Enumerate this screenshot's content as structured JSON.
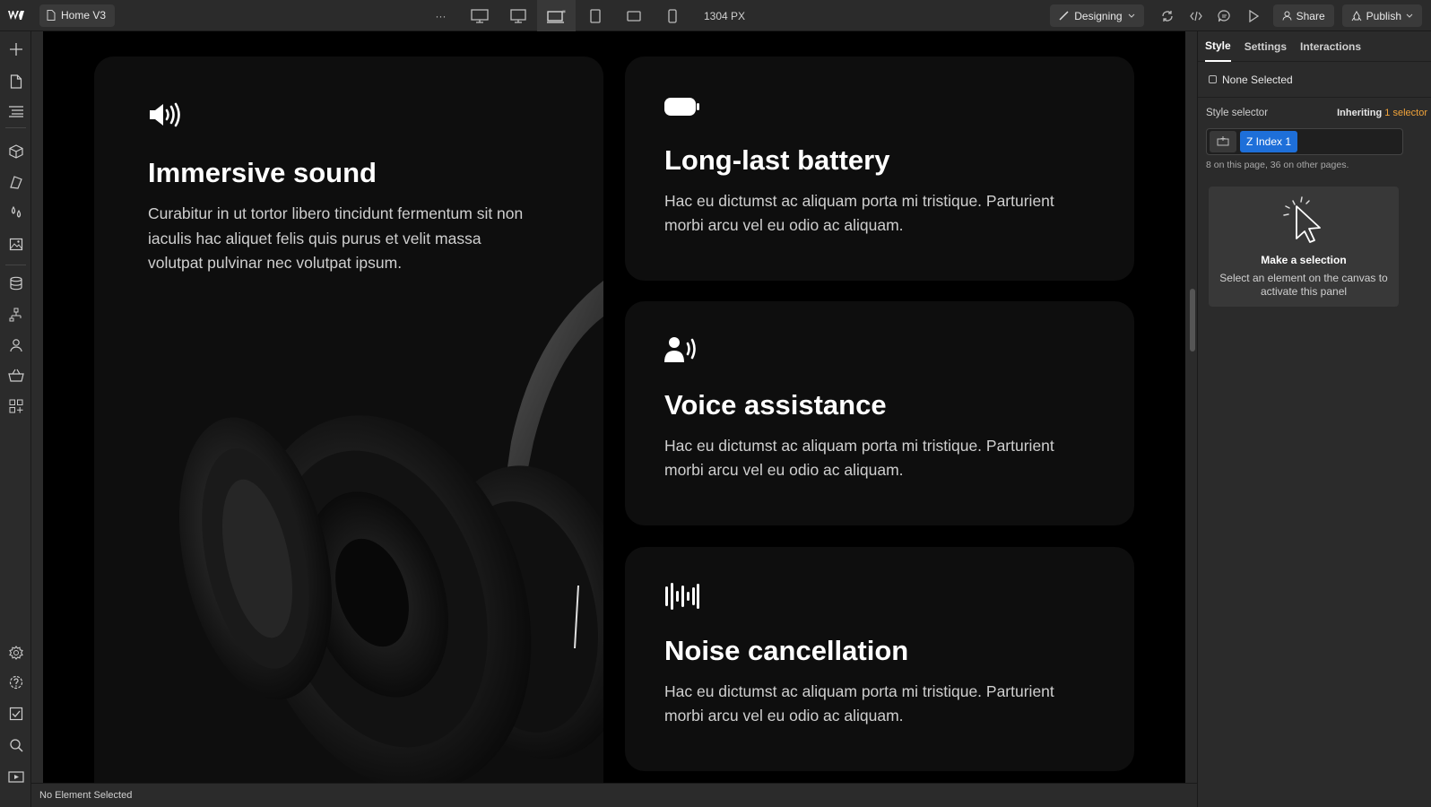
{
  "topbar": {
    "page_name": "Home V3",
    "more_label": "···",
    "width_readout": "1304 PX",
    "mode_label": "Designing",
    "share_label": "Share",
    "publish_label": "Publish"
  },
  "canvas": {
    "feature_main": {
      "title": "Immersive sound",
      "text": "Curabitur in ut tortor libero tincidunt fermentum sit non iaculis hac aliquet felis quis purus et velit massa volutpat pulvinar nec volutpat ipsum."
    },
    "features": [
      {
        "icon": "battery-icon",
        "title": "Long-last battery",
        "text": "Hac eu dictumst ac aliquam porta mi tristique. Parturient morbi arcu vel eu odio ac aliquam."
      },
      {
        "icon": "voice-icon",
        "title": "Voice assistance",
        "text": "Hac eu dictumst ac aliquam porta mi tristique. Parturient morbi arcu vel eu odio ac aliquam."
      },
      {
        "icon": "waveform-icon",
        "title": "Noise cancellation",
        "text": "Hac eu dictumst ac aliquam porta mi tristique. Parturient morbi arcu vel eu odio ac aliquam."
      }
    ]
  },
  "statusbar": {
    "text": "No Element Selected"
  },
  "panel": {
    "tabs": [
      "Style",
      "Settings",
      "Interactions"
    ],
    "none_selected": "None Selected",
    "style_selector_label": "Style selector",
    "inheriting_prefix": "Inheriting",
    "inheriting_count": "1 selector",
    "selector_chip": "Z Index 1",
    "count_note": "8 on this page, 36 on other pages.",
    "empty_title": "Make a selection",
    "empty_text": "Select an element on the canvas to activate this panel"
  },
  "colors": {
    "accent": "#1e6fd9",
    "inherit_accent": "#f0a33a",
    "canvas_bg": "#000000",
    "card_bg": "#0e0e0e"
  }
}
